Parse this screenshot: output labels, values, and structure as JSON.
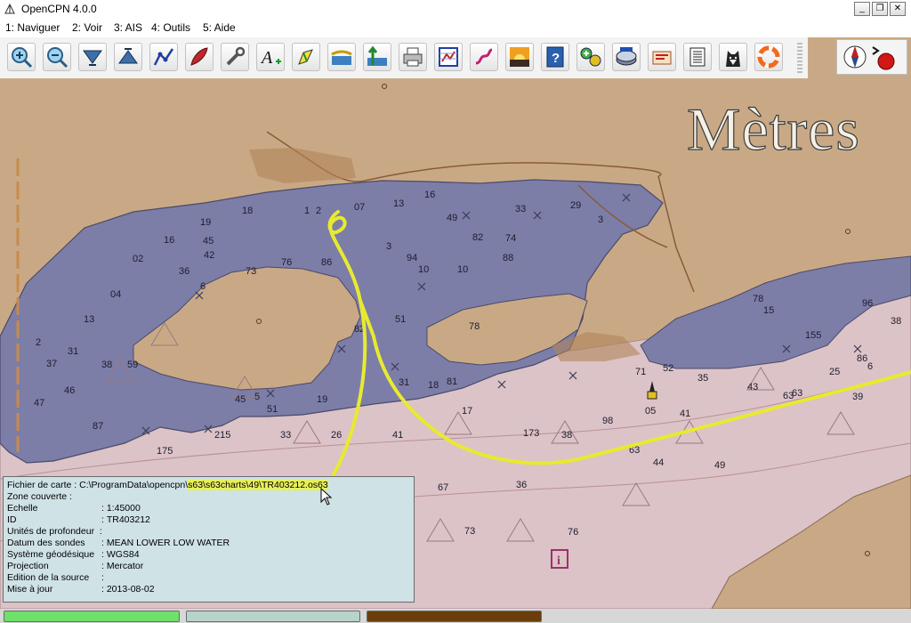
{
  "window": {
    "title": "OpenCPN 4.0.0",
    "minimize_label": "_",
    "maximize_label": "❐",
    "close_label": "✕"
  },
  "menu": {
    "items": [
      {
        "label": "1: Naviguer"
      },
      {
        "label": "2: Voir"
      },
      {
        "label": "3: AIS"
      },
      {
        "label": "4: Outils"
      },
      {
        "label": "5: Aide"
      }
    ]
  },
  "toolbar": {
    "icons": [
      "zoom-in-icon",
      "zoom-out-icon",
      "scale-down-icon",
      "scale-up-icon",
      "route-icon",
      "boat-icon",
      "settings-tools-icon",
      "text-annotation-icon",
      "pencil-mark-icon",
      "current-tide-icon",
      "tide-arrow-icon",
      "print-icon",
      "route-manager-icon",
      "track-icon",
      "sunrise-icon",
      "help-icon",
      "ais-grib-icon",
      "chart-dl-icon",
      "tools-icon",
      "text-doc-icon",
      "dog-icon",
      "lifebuoy-icon"
    ]
  },
  "map": {
    "scale_unit": "Mètres",
    "depth_labels": [
      {
        "t": "1"
      },
      {
        "t": "2"
      },
      {
        "t": "07"
      },
      {
        "t": "13"
      },
      {
        "t": "16"
      },
      {
        "t": "33"
      },
      {
        "t": "29"
      },
      {
        "t": "3"
      },
      {
        "t": "19"
      },
      {
        "t": "18"
      },
      {
        "t": "45"
      },
      {
        "t": "49"
      },
      {
        "t": "82"
      },
      {
        "t": "74"
      },
      {
        "t": "02"
      },
      {
        "t": "16"
      },
      {
        "t": "42"
      },
      {
        "t": "76"
      },
      {
        "t": "86"
      },
      {
        "t": "94"
      },
      {
        "t": "88"
      },
      {
        "t": "3"
      },
      {
        "t": "36"
      },
      {
        "t": "6"
      },
      {
        "t": "73"
      },
      {
        "t": "04"
      },
      {
        "t": "10"
      },
      {
        "t": "10"
      },
      {
        "t": "13"
      },
      {
        "t": "51"
      },
      {
        "t": "82"
      },
      {
        "t": "78"
      },
      {
        "t": "2"
      },
      {
        "t": "31"
      },
      {
        "t": "37"
      },
      {
        "t": "38"
      },
      {
        "t": "59"
      },
      {
        "t": "46"
      },
      {
        "t": "47"
      },
      {
        "t": "87"
      },
      {
        "t": "45"
      },
      {
        "t": "5"
      },
      {
        "t": "51"
      },
      {
        "t": "31"
      },
      {
        "t": "18"
      },
      {
        "t": "81"
      },
      {
        "t": "71"
      },
      {
        "t": "52"
      },
      {
        "t": "05"
      },
      {
        "t": "41"
      },
      {
        "t": "35"
      },
      {
        "t": "43"
      },
      {
        "t": "63"
      },
      {
        "t": "25"
      },
      {
        "t": "39"
      },
      {
        "t": "96"
      },
      {
        "t": "15"
      },
      {
        "t": "78"
      },
      {
        "t": "155"
      },
      {
        "t": "38"
      },
      {
        "t": "86"
      },
      {
        "t": "6"
      },
      {
        "t": "19"
      },
      {
        "t": "17"
      },
      {
        "t": "44"
      },
      {
        "t": "63"
      },
      {
        "t": "49"
      },
      {
        "t": "36"
      },
      {
        "t": "67"
      },
      {
        "t": "73"
      },
      {
        "t": "76"
      },
      {
        "t": "63"
      },
      {
        "t": "175"
      },
      {
        "t": "215"
      },
      {
        "t": "33"
      },
      {
        "t": "26"
      },
      {
        "t": "41"
      },
      {
        "t": "173"
      },
      {
        "t": "38"
      },
      {
        "t": "98"
      }
    ]
  },
  "info_panel": {
    "rows": [
      {
        "key": "Fichier de carte",
        "sep": ":",
        "value_plain": "C:\\ProgramData\\opencpn\\",
        "value_hl": "s63\\s63charts\\49\\TR403212.os63"
      },
      {
        "key": "Zone couverte",
        "sep": ":",
        "value": ""
      },
      {
        "key": "Echelle",
        "sep": ":",
        "value": "1:45000"
      },
      {
        "key": "ID",
        "sep": ":",
        "value": "TR403212"
      },
      {
        "key": "Unités de profondeur",
        "sep": ":",
        "value": ""
      },
      {
        "key": "Datum des sondes",
        "sep": ":",
        "value": "MEAN LOWER LOW WATER"
      },
      {
        "key": "Système géodésique",
        "sep": ":",
        "value": "WGS84"
      },
      {
        "key": "Projection",
        "sep": ":",
        "value": "Mercator"
      },
      {
        "key": "Edition de la source",
        "sep": ":",
        "value": ""
      },
      {
        "key": "Mise à jour",
        "sep": ":",
        "value": "2013-08-02"
      }
    ]
  },
  "status_bar": {
    "segments": [
      {
        "color": "#6fe06a"
      },
      {
        "color": "#b8d3cc"
      },
      {
        "color": "#6b3d0a"
      }
    ]
  },
  "colors": {
    "land": "#c9a985",
    "shallow_water": "#7c7ea8",
    "deep_water": "#d9c0c4",
    "track": "#e8ea2e",
    "info_bg": "#cfe2e6"
  }
}
